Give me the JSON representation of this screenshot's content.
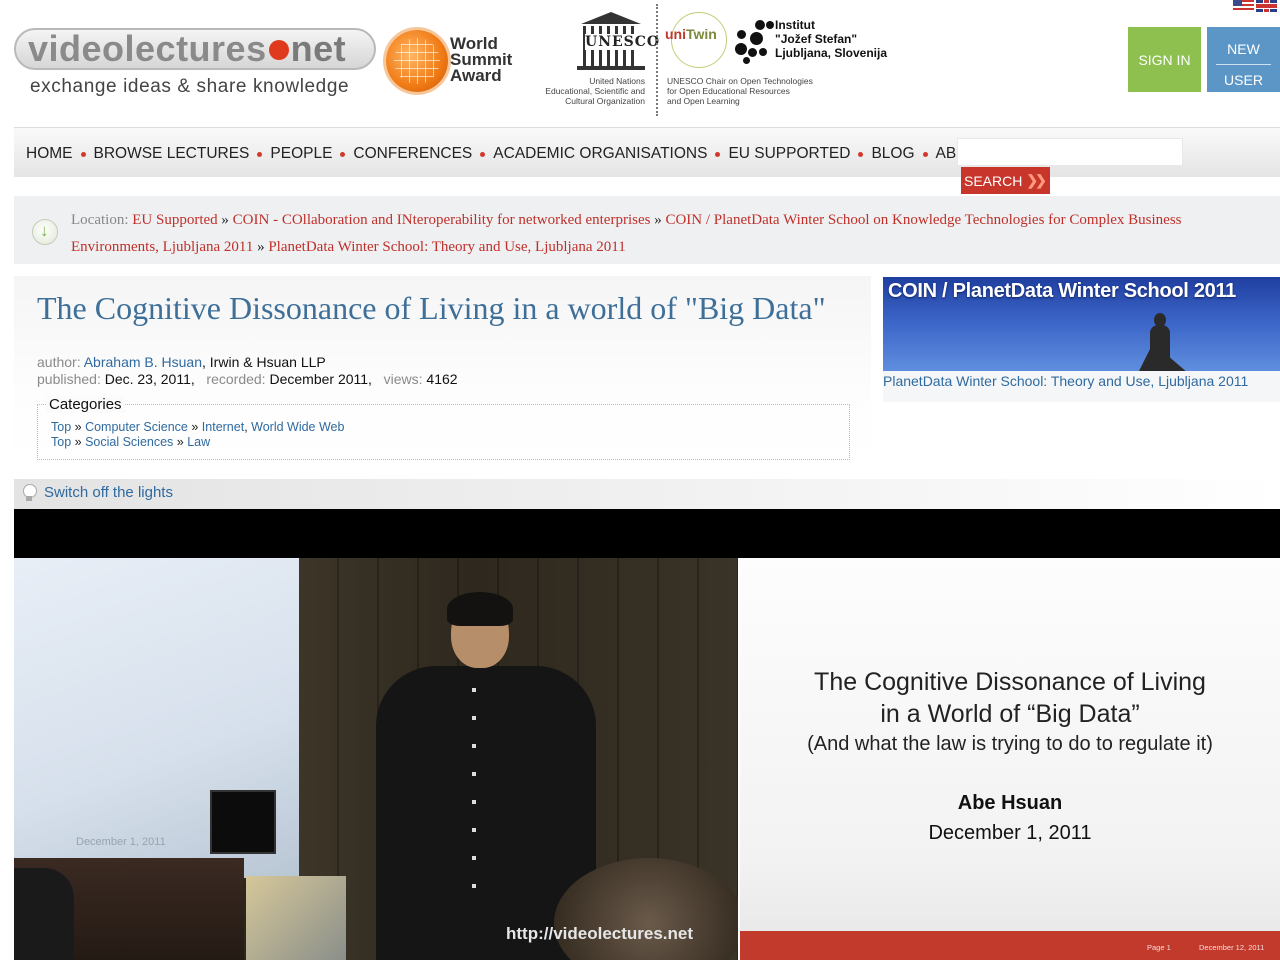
{
  "header": {
    "logo": {
      "main": "videolectures",
      "net": "net",
      "tagline": "exchange ideas & share knowledge"
    },
    "wsa": {
      "line1": "World",
      "line2": "Summit",
      "line3": "Award"
    },
    "unesco": {
      "word": "UNESCO",
      "line1": "United Nations",
      "line2": "Educational, Scientific and",
      "line3": "Cultural Organization"
    },
    "unitwin": {
      "name_a": "uni",
      "name_b": "Twin",
      "line1": "UNESCO Chair on Open Technologies",
      "line2": "for Open Educational Resources",
      "line3": "and Open Learning"
    },
    "ijs": {
      "line1": "Institut",
      "line2": "\"Jožef Stefan\"",
      "line3": "Ljubljana, Slovenija"
    },
    "sign_in": "SIGN IN",
    "new_user_line1": "NEW",
    "new_user_line2": "USER"
  },
  "nav": {
    "items": [
      "HOME",
      "BROWSE LECTURES",
      "PEOPLE",
      "CONFERENCES",
      "ACADEMIC ORGANISATIONS",
      "EU SUPPORTED",
      "BLOG",
      "ABOUT US"
    ],
    "search_value": "",
    "search_button": "SEARCH"
  },
  "location": {
    "label": "Location:",
    "crumbs": [
      "EU Supported",
      "COIN - COllaboration and INteroperability for networked enterprises",
      "COIN / PlanetData Winter School on Knowledge Technologies for Complex Business Environments, Ljubljana 2011",
      "PlanetData Winter School: Theory and Use, Ljubljana 2011"
    ],
    "separator": "»"
  },
  "lecture": {
    "title": "The Cognitive Dissonance of Living in a world of \"Big Data\"",
    "author_label": "author:",
    "author_name": "Abraham B. Hsuan",
    "author_org": ", Irwin & Hsuan LLP",
    "published_label": "published:",
    "published": "Dec. 23, 2011,",
    "recorded_label": "recorded:",
    "recorded": "December 2011,",
    "views_label": "views:",
    "views": "4162",
    "categories_title": "Categories",
    "cat1": [
      "Top",
      "Computer Science",
      "Internet",
      "World Wide Web"
    ],
    "cat2": [
      "Top",
      "Social Sciences",
      "Law"
    ]
  },
  "event": {
    "banner_title": "COIN / PlanetData Winter School 2011",
    "caption": "PlanetData Winter School: Theory and Use, Ljubljana 2011"
  },
  "lights": {
    "label": "Switch off the lights"
  },
  "video": {
    "watermark": "http://videolectures.net",
    "screen_date": "December 1, 2011"
  },
  "slide": {
    "title_line1": "The Cognitive Dissonance of Living",
    "title_line2": "in a World of “Big Data”",
    "subtitle": "(And what the law is trying to do to regulate it)",
    "author": "Abe Hsuan",
    "date": "December 1, 2011",
    "footer_page": "Page 1",
    "footer_date": "December 12, 2011"
  },
  "colors": {
    "accent_red": "#c7352b",
    "link_blue": "#2f6aa0",
    "title_blue": "#3e6f99",
    "sign_in_green": "#8dc04f",
    "new_user_blue": "#5b96c7"
  }
}
